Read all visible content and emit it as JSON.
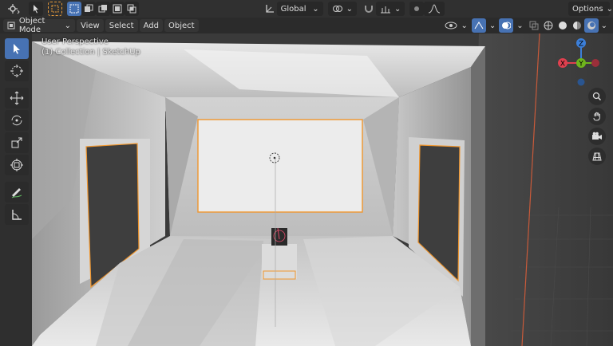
{
  "topbar": {
    "transform_orientation": "Global",
    "options_label": "Options"
  },
  "header": {
    "mode_label": "Object Mode",
    "menus": [
      "View",
      "Select",
      "Add",
      "Object"
    ]
  },
  "overlay": {
    "perspective": "User Perspective",
    "collection": "(1) Collection | SketchUp"
  },
  "gizmo": {
    "x_label": "X",
    "y_label": "Y",
    "z_label": "Z",
    "x_color": "#e0404f",
    "y_color": "#6fb51d",
    "z_color": "#3c7fd9"
  },
  "colors": {
    "accent": "#4772b3",
    "selection": "#f0962e"
  }
}
